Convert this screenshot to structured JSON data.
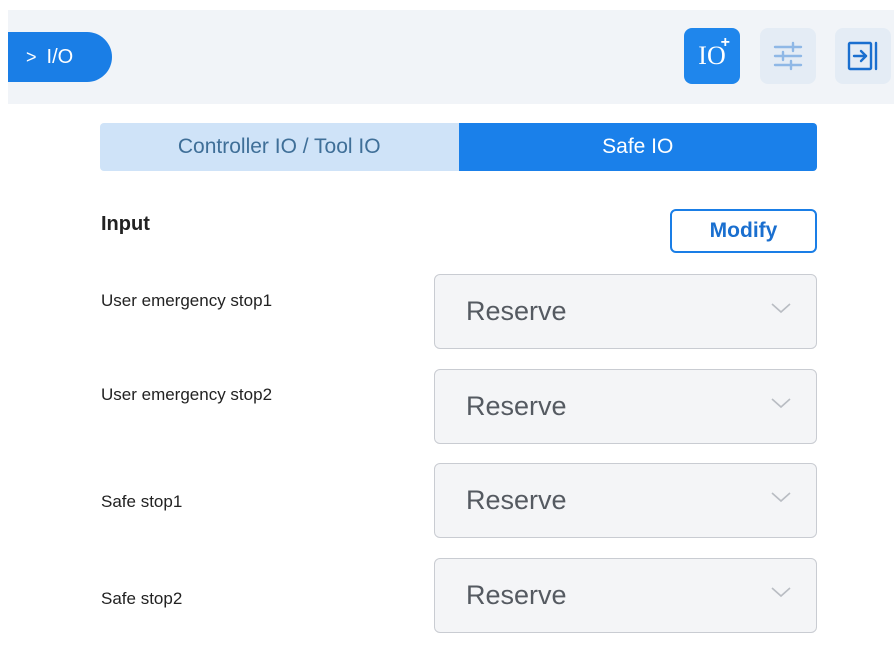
{
  "header": {
    "breadcrumb_chevron": ">",
    "breadcrumb_label": "I/O",
    "io_add_label": "IO",
    "io_add_plus": "+",
    "accent_color": "#1a7ee6"
  },
  "tabs": [
    {
      "label": "Controller IO / Tool IO",
      "active": false
    },
    {
      "label": "Safe IO",
      "active": true
    }
  ],
  "section": {
    "title": "Input",
    "modify_label": "Modify"
  },
  "rows": [
    {
      "label": "User emergency stop1",
      "value": "Reserve"
    },
    {
      "label": "User emergency stop2",
      "value": "Reserve"
    },
    {
      "label": "Safe stop1",
      "value": "Reserve"
    },
    {
      "label": "Safe stop2",
      "value": "Reserve"
    }
  ],
  "icons": {
    "breadcrumb": "chevron-right-icon",
    "io_add": "io-add-icon",
    "filter": "sliders-icon",
    "exit": "exit-icon",
    "select": "chevron-down-icon"
  }
}
